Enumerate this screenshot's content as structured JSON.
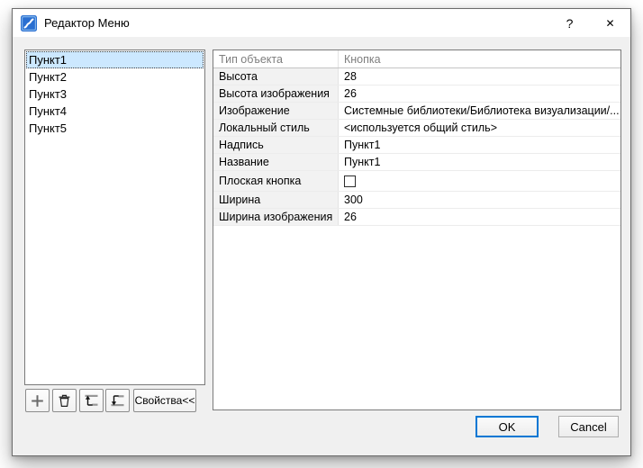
{
  "window": {
    "title": "Редактор Меню",
    "help_glyph": "?",
    "close_glyph": "✕",
    "app_icon": "blue-squiggle-app-icon"
  },
  "menu_list": {
    "selected_index": 0,
    "items": [
      "Пункт1",
      "Пункт2",
      "Пункт3",
      "Пункт4",
      "Пункт5"
    ]
  },
  "toolbar": {
    "add_icon": "plus-icon",
    "delete_icon": "trash-icon",
    "move_up_icon": "move-up-icon",
    "move_down_icon": "move-down-icon",
    "properties_label": "Свойства<<"
  },
  "properties": {
    "header": {
      "name": "Тип объекта",
      "value": "Кнопка"
    },
    "rows": [
      {
        "name": "Высота",
        "value": "28"
      },
      {
        "name": "Высота изображения",
        "value": "26"
      },
      {
        "name": "Изображение",
        "value": "Системные библиотеки/Библиотека визуализации/..."
      },
      {
        "name": "Локальный стиль",
        "value": "<используется общий стиль>"
      },
      {
        "name": "Надпись",
        "value": "Пункт1"
      },
      {
        "name": "Название",
        "value": "Пункт1"
      },
      {
        "name": "Плоская кнопка",
        "value": "",
        "type": "checkbox",
        "checked": false
      },
      {
        "name": "Ширина",
        "value": "300"
      },
      {
        "name": "Ширина изображения",
        "value": "26"
      }
    ]
  },
  "footer": {
    "ok_label": "OK",
    "cancel_label": "Cancel"
  },
  "colors": {
    "accent": "#0077d4",
    "selection_bg": "#cce8ff",
    "client_bg": "#f0f0f0",
    "titlebar_bg": "#ffffff"
  }
}
